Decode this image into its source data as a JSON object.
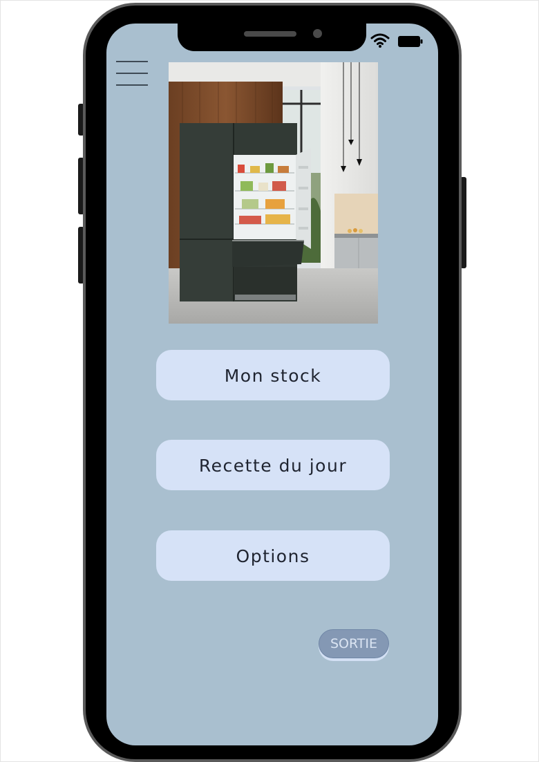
{
  "menu": {
    "icon": "hamburger-menu-icon"
  },
  "status_bar": {
    "wifi_icon": "wifi-icon",
    "battery_icon": "battery-icon"
  },
  "hero": {
    "image": "refrigerator-kitchen-photo"
  },
  "buttons": {
    "stock": "Mon stock",
    "recipe": "Recette du jour",
    "options": "Options",
    "exit": "SORTIE"
  },
  "colors": {
    "screen_background": "#a9bfcf",
    "button_background": "#d6e2f7",
    "button_text": "#1f2430",
    "exit_button_background": "#8498b4",
    "exit_button_text": "#dbe5f3"
  }
}
